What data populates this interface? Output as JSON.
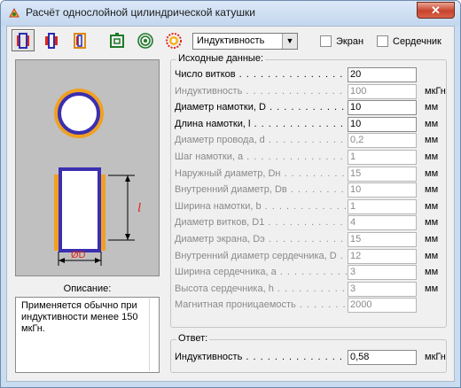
{
  "window": {
    "title": "Расчёт однослойной цилиндрической катушки",
    "close_label": "✕"
  },
  "toolbar": {
    "mode_select_value": "Индуктивность",
    "screen_label": "Экран",
    "core_label": "Сердечник",
    "screen_checked": false,
    "core_checked": false
  },
  "diagram": {
    "length_symbol": "l",
    "diameter_symbol": "ØD",
    "colors": {
      "winding": "#3a2fb0",
      "body": "#f0a020",
      "dimension": "#000000",
      "background": "#c0c0c0"
    }
  },
  "description": {
    "label": "Описание:",
    "text": "    Применяется обычно при индуктивности менее 150 мкГн."
  },
  "params": {
    "group_label": "Исходные данные:",
    "rows": [
      {
        "label": "Число витков",
        "value": "20",
        "unit": "",
        "enabled": true
      },
      {
        "label": "Индуктивность",
        "value": "100",
        "unit": "мкГн",
        "enabled": false
      },
      {
        "label": "Диаметр намотки, D",
        "value": "10",
        "unit": "мм",
        "enabled": true
      },
      {
        "label": "Длина намотки, l",
        "value": "10",
        "unit": "мм",
        "enabled": true
      },
      {
        "label": "Диаметр провода, d",
        "value": "0,2",
        "unit": "мм",
        "enabled": false
      },
      {
        "label": "Шаг намотки, a",
        "value": "1",
        "unit": "мм",
        "enabled": false
      },
      {
        "label": "Наружный диаметр, Dн",
        "value": "15",
        "unit": "мм",
        "enabled": false
      },
      {
        "label": "Внутренний диаметр, Dв",
        "value": "10",
        "unit": "мм",
        "enabled": false
      },
      {
        "label": "Ширина намотки, b",
        "value": "1",
        "unit": "мм",
        "enabled": false
      },
      {
        "label": "Диаметр витков, D1",
        "value": "4",
        "unit": "мм",
        "enabled": false
      },
      {
        "label": "Диаметр экрана, Dэ",
        "value": "15",
        "unit": "мм",
        "enabled": false
      },
      {
        "label": "Внутренний диаметр сердечника, D",
        "value": "12",
        "unit": "мм",
        "enabled": false
      },
      {
        "label": "Ширина сердечника, a",
        "value": "3",
        "unit": "мм",
        "enabled": false
      },
      {
        "label": "Высота сердечника, h",
        "value": "3",
        "unit": "мм",
        "enabled": false
      },
      {
        "label": "Магнитная проницаемость",
        "value": "2000",
        "unit": "",
        "enabled": false
      }
    ]
  },
  "answer": {
    "group_label": "Ответ:",
    "label": "Индуктивность",
    "value": "0,58",
    "unit": "мкГн"
  }
}
